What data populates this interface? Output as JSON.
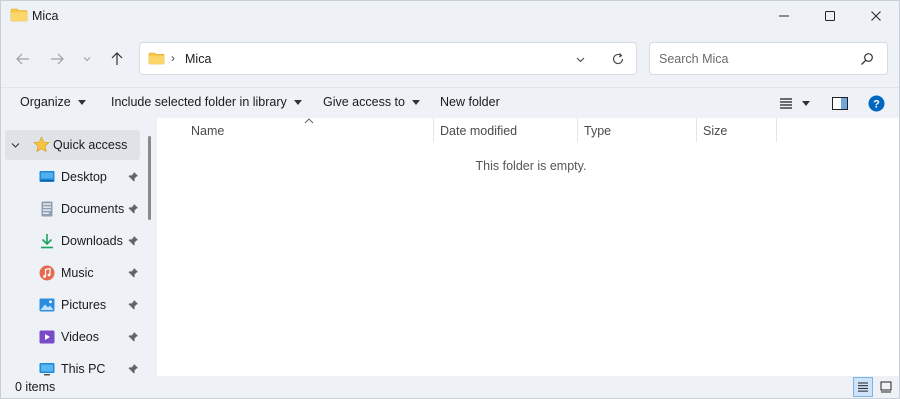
{
  "window": {
    "title": "Mica",
    "controls": [
      "minimize-icon",
      "maximize-icon",
      "close-icon"
    ]
  },
  "navigation": {
    "back_icon": "arrow-left-icon",
    "forward_icon": "arrow-right-icon",
    "recent_icon": "chevron-down-icon",
    "up_icon": "arrow-up-icon"
  },
  "address": {
    "separator": "›",
    "path": "Mica"
  },
  "search": {
    "placeholder": "Search Mica"
  },
  "commands": {
    "organize": "Organize",
    "include_library": "Include selected folder in library",
    "give_access": "Give access to",
    "new_folder": "New folder"
  },
  "nav_pane": {
    "quick_access": "Quick access",
    "items": [
      {
        "label": "Desktop",
        "icon": "desktop-icon",
        "pinned": true
      },
      {
        "label": "Documents",
        "icon": "documents-icon",
        "pinned": true
      },
      {
        "label": "Downloads",
        "icon": "download-icon",
        "pinned": true
      },
      {
        "label": "Music",
        "icon": "music-icon",
        "pinned": true
      },
      {
        "label": "Pictures",
        "icon": "pictures-icon",
        "pinned": true
      },
      {
        "label": "Videos",
        "icon": "videos-icon",
        "pinned": true
      },
      {
        "label": "This PC",
        "icon": "this-pc-icon",
        "pinned": true
      }
    ]
  },
  "columns": [
    "Name",
    "Date modified",
    "Type",
    "Size"
  ],
  "empty_message": "This folder is empty.",
  "status": {
    "item_count": "0 items"
  },
  "colors": {
    "accent": "#0067c0",
    "folder": "#f8c94a",
    "background": "#eef2f6"
  }
}
